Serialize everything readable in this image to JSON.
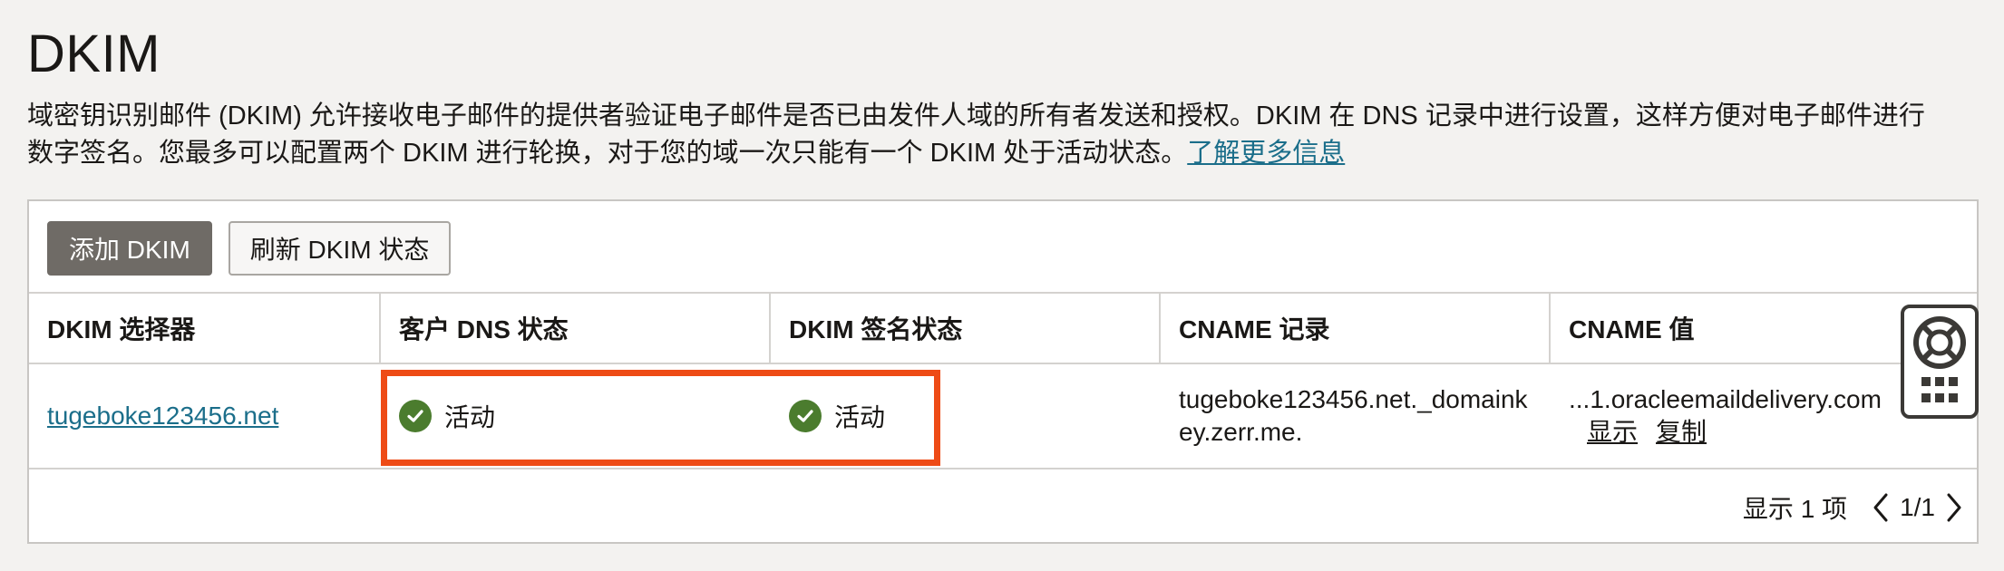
{
  "header": {
    "title": "DKIM",
    "description": "域密钥识别邮件 (DKIM) 允许接收电子邮件的提供者验证电子邮件是否已由发件人域的所有者发送和授权。DKIM 在 DNS 记录中进行设置，这样方便对电子邮件进行数字签名。您最多可以配置两个 DKIM 进行轮换，对于您的域一次只能有一个 DKIM 处于活动状态。",
    "learn_more": "了解更多信息"
  },
  "toolbar": {
    "add_label": "添加 DKIM",
    "refresh_label": "刷新 DKIM 状态"
  },
  "table": {
    "columns": [
      "DKIM 选择器",
      "客户 DNS 状态",
      "DKIM 签名状态",
      "CNAME 记录",
      "CNAME 值"
    ],
    "rows": [
      {
        "selector": "tugeboke123456.net",
        "dns_status": "活动",
        "signing_status": "活动",
        "cname_record": "tugeboke123456.net._domainkey.zerr.me.",
        "cname_value": "...1.oracleemaildelivery.com",
        "show": "显示",
        "copy": "复制"
      }
    ]
  },
  "footer": {
    "count": "显示 1 项",
    "page": "1/1"
  },
  "colors": {
    "status_ok": "#4b7c2e",
    "highlight": "#ee4b16",
    "link": "#1b6e8a",
    "primary_button": "#6f6b66"
  },
  "icons": [
    "check-circle-icon",
    "chevron-left-icon",
    "chevron-right-icon",
    "lifebuoy-icon",
    "grid-dots-icon"
  ]
}
